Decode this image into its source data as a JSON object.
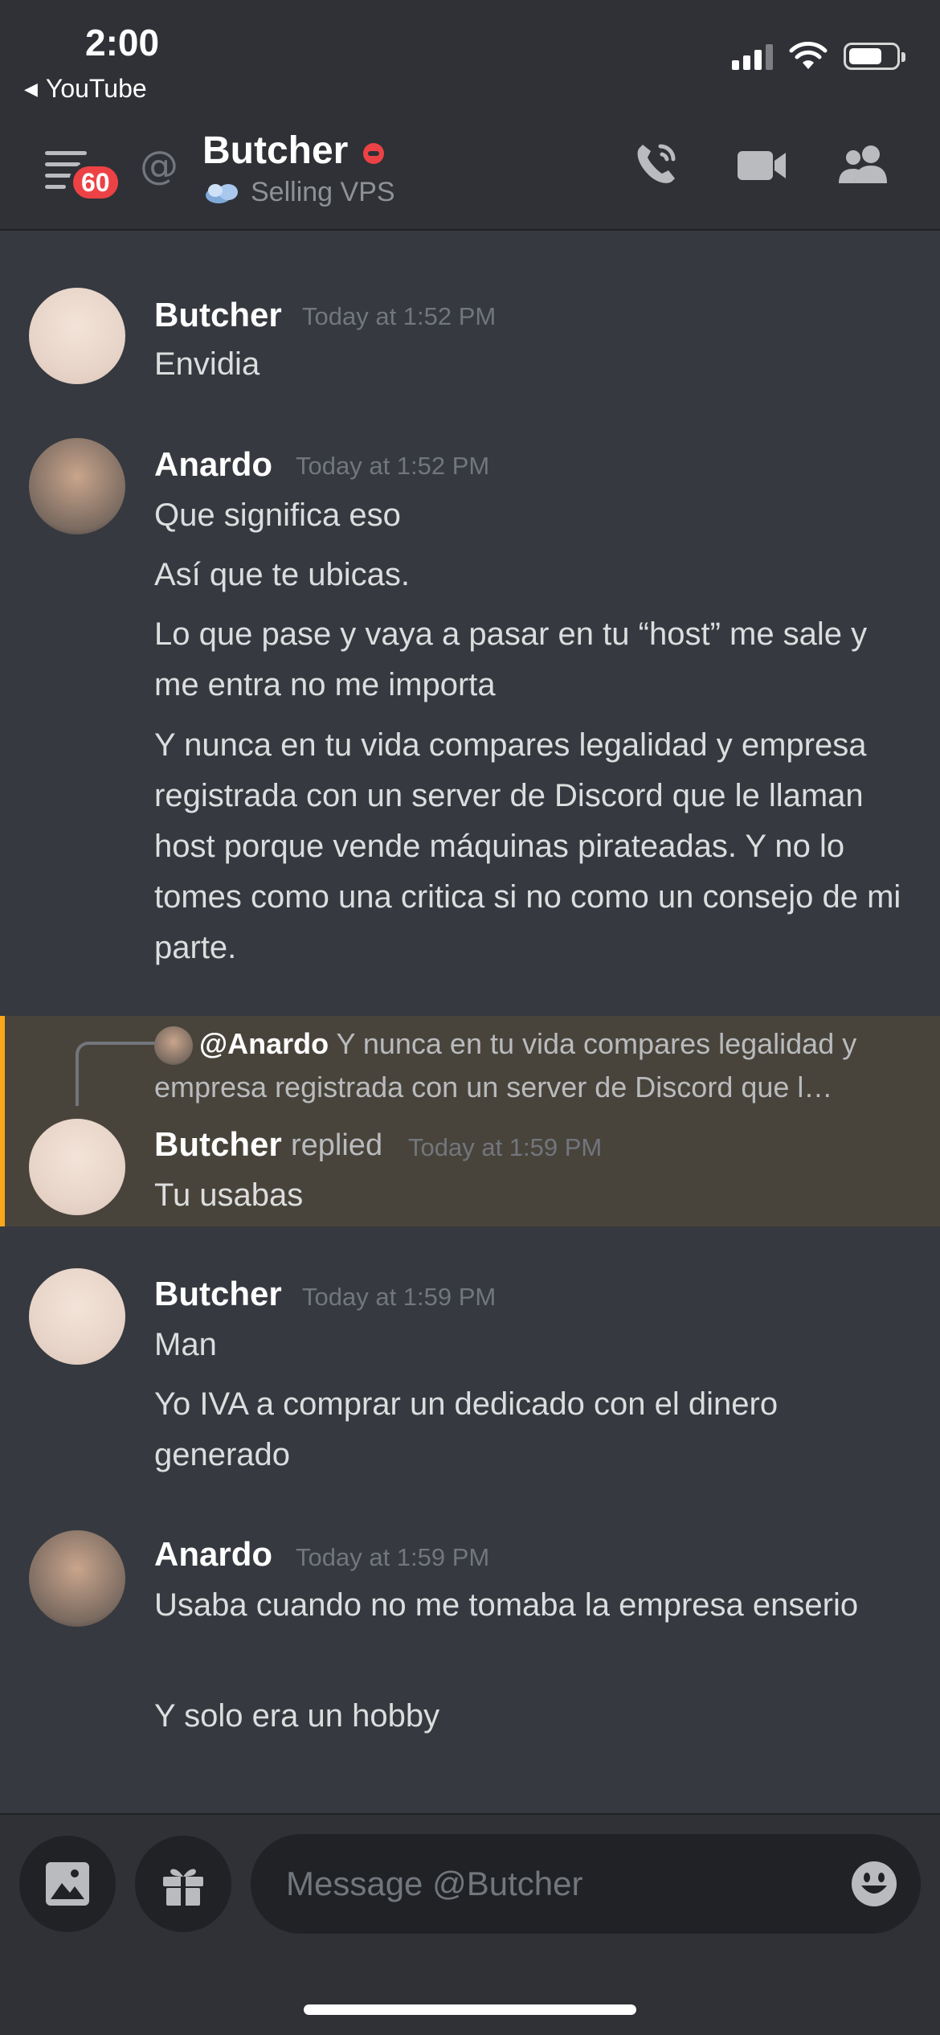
{
  "status_bar": {
    "time": "2:00",
    "back_app": "YouTube"
  },
  "header": {
    "unread_count": "60",
    "name": "Butcher",
    "custom_status": "Selling VPS",
    "colors": {
      "dnd": "#ed4245",
      "badge": "#ed4245"
    }
  },
  "messages": [
    {
      "author": "Butcher",
      "timestamp": "Today at 1:52 PM",
      "lines": [
        "Envidia"
      ]
    },
    {
      "author": "Anardo",
      "timestamp": "Today at 1:52 PM",
      "lines": [
        "Que significa eso",
        "Así que te ubicas.",
        "Lo que pase y vaya a pasar en tu “host” me sale y me entra no me importa",
        "Y nunca en tu vida compares legalidad y empresa registrada con un server de Discord que le llaman host porque vende máquinas pirateadas. Y no lo tomes como una critica si no como un consejo de mi parte."
      ]
    },
    {
      "author": "Butcher",
      "replied_label": "replied",
      "timestamp": "Today at 1:59 PM",
      "reply_to": {
        "mention": "@Anardo",
        "preview": "Y nunca en tu vida compares legalidad y empresa registrada con un server de Discord que l…"
      },
      "lines": [
        "Tu usabas"
      ]
    },
    {
      "author": "Butcher",
      "timestamp": "Today at 1:59 PM",
      "lines": [
        "Man",
        "Yo IVA a comprar un dedicado con el dinero generado"
      ]
    },
    {
      "author": "Anardo",
      "timestamp": "Today at 1:59 PM",
      "lines": [
        "Usaba cuando no me tomaba la empresa enserio",
        "Y solo era un hobby"
      ]
    }
  ],
  "composer": {
    "placeholder": "Message @Butcher"
  }
}
